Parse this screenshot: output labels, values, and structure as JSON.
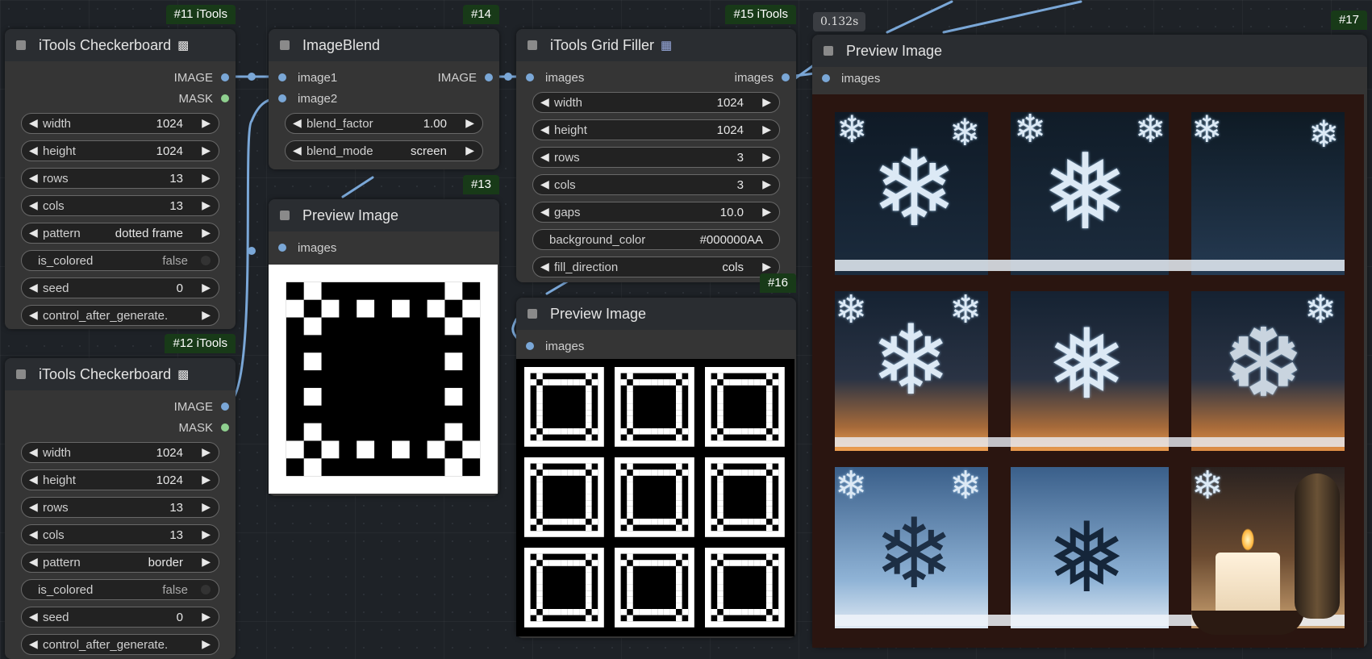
{
  "timer": "0.132s",
  "nodes": {
    "n11": {
      "badge": "#11 iTools",
      "title": "iTools Checkerboard",
      "icon": "checkerboard-emoji",
      "outputs": [
        "IMAGE",
        "MASK"
      ],
      "widgets": [
        {
          "label": "width",
          "value": "1024"
        },
        {
          "label": "height",
          "value": "1024"
        },
        {
          "label": "rows",
          "value": "13"
        },
        {
          "label": "cols",
          "value": "13"
        },
        {
          "label": "pattern",
          "value": "dotted frame"
        },
        {
          "label": "is_colored",
          "value": "false"
        },
        {
          "label": "seed",
          "value": "0"
        },
        {
          "label": "control_after_generate.",
          "value": ""
        }
      ]
    },
    "n12": {
      "badge": "#12 iTools",
      "title": "iTools Checkerboard",
      "icon": "checkerboard-emoji",
      "outputs": [
        "IMAGE",
        "MASK"
      ],
      "widgets": [
        {
          "label": "width",
          "value": "1024"
        },
        {
          "label": "height",
          "value": "1024"
        },
        {
          "label": "rows",
          "value": "13"
        },
        {
          "label": "cols",
          "value": "13"
        },
        {
          "label": "pattern",
          "value": "border"
        },
        {
          "label": "is_colored",
          "value": "false"
        },
        {
          "label": "seed",
          "value": "0"
        },
        {
          "label": "control_after_generate.",
          "value": ""
        }
      ]
    },
    "n14": {
      "badge": "#14",
      "title": "ImageBlend",
      "inputs": [
        "image1",
        "image2"
      ],
      "output": "IMAGE",
      "widgets": [
        {
          "label": "blend_factor",
          "value": "1.00"
        },
        {
          "label": "blend_mode",
          "value": "screen"
        }
      ]
    },
    "n13": {
      "badge": "#13",
      "title": "Preview Image",
      "input": "images"
    },
    "n15": {
      "badge": "#15 iTools",
      "title": "iTools Grid Filler",
      "icon": "grid-emoji",
      "input": "images",
      "output": "images",
      "widgets": [
        {
          "label": "width",
          "value": "1024"
        },
        {
          "label": "height",
          "value": "1024"
        },
        {
          "label": "rows",
          "value": "3"
        },
        {
          "label": "cols",
          "value": "3"
        },
        {
          "label": "gaps",
          "value": "10.0"
        },
        {
          "label": "background_color",
          "value": "#000000AA"
        },
        {
          "label": "fill_direction",
          "value": "cols"
        }
      ]
    },
    "n16": {
      "badge": "#16",
      "title": "Preview Image",
      "input": "images"
    },
    "n17": {
      "badge": "#17",
      "title": "Preview Image",
      "input": "images"
    }
  },
  "colors": {
    "wire": "#7aa7d7",
    "mask_dot": "#8fd08f",
    "badge_bg": "#183a18",
    "node_bg": "#353535",
    "canvas_bg": "#1e2227"
  }
}
